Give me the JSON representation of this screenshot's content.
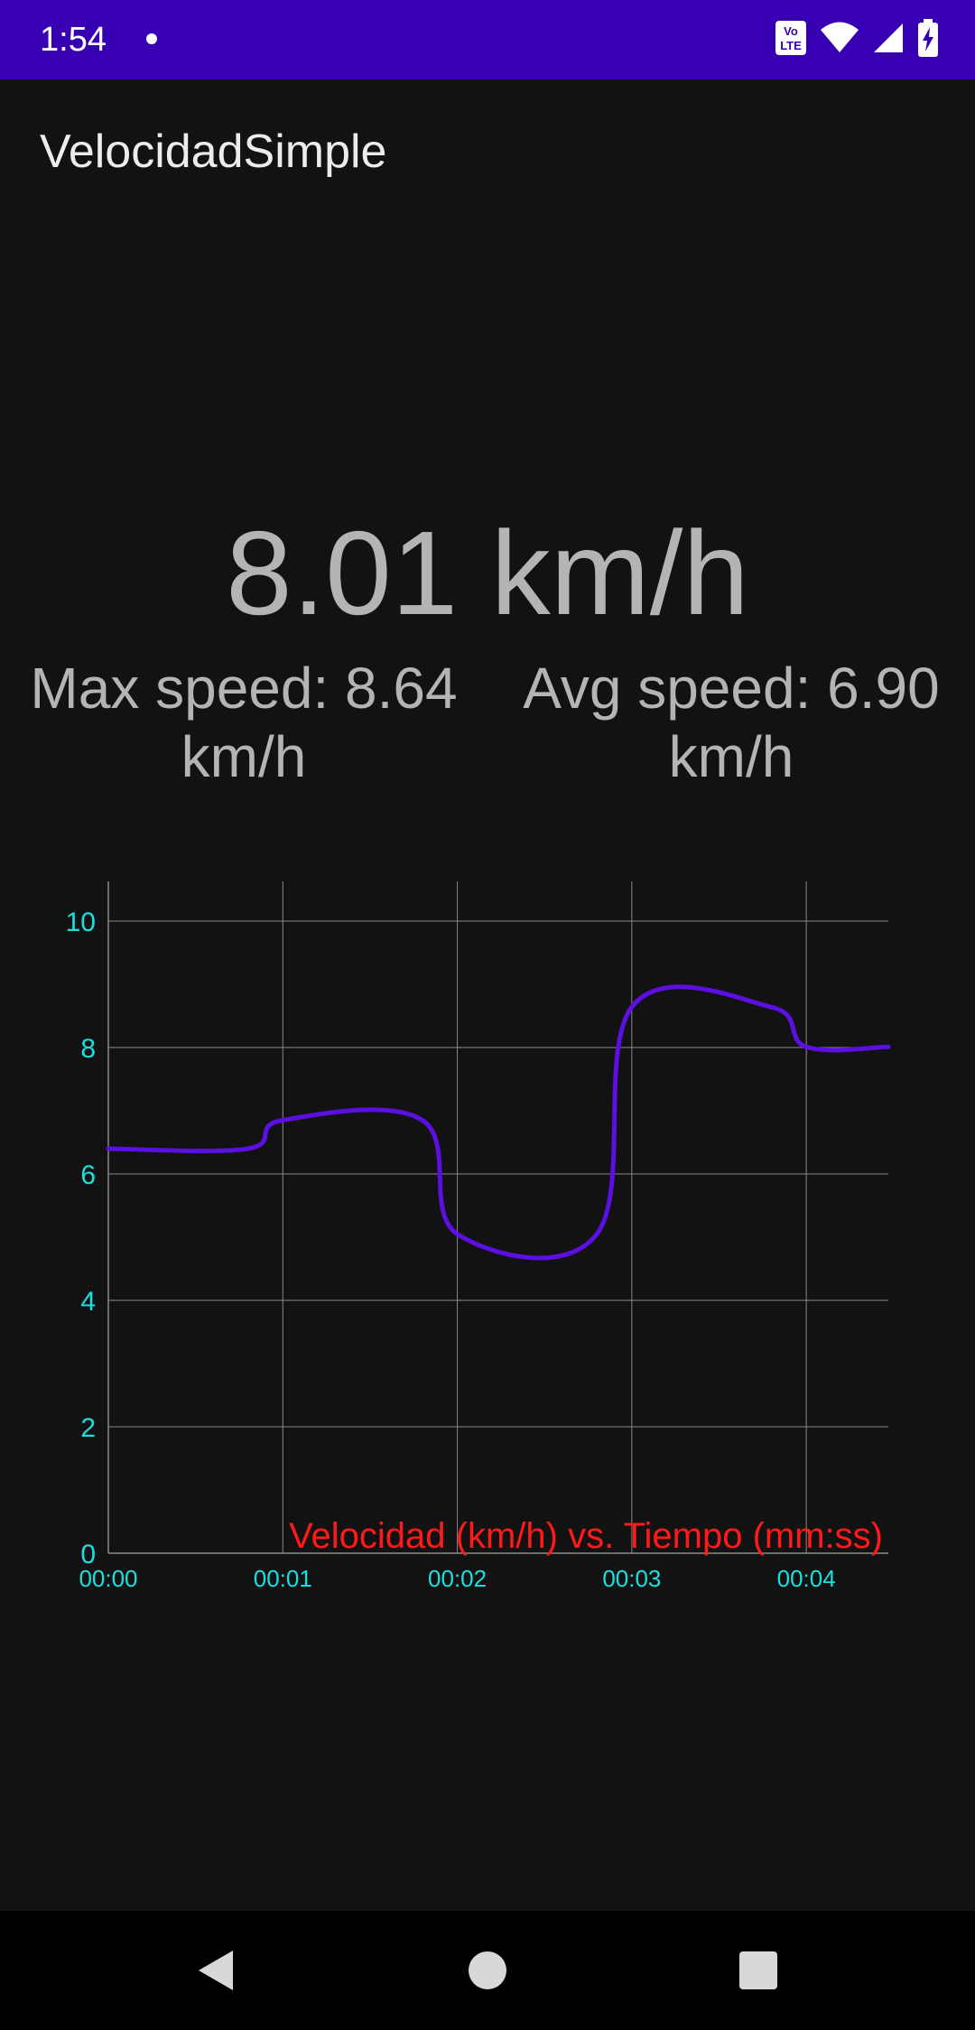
{
  "status_bar": {
    "time": "1:54",
    "icons": [
      "volte-icon",
      "wifi-icon",
      "signal-icon",
      "battery-charging-icon"
    ],
    "volte_label": "Vo LTE"
  },
  "app_bar": {
    "title": "VelocidadSimple"
  },
  "speed": {
    "current": "8.01 km/h",
    "max": "Max speed: 8.64 km/h",
    "avg": "Avg speed: 6.90 km/h"
  },
  "colors": {
    "status_bar": "#3700b3",
    "background": "#121212",
    "speed_text": "#b4b4b4",
    "series": "#5b0fe0",
    "axis_labels": "#19e0e0",
    "chart_title": "#ff1a1a",
    "grid": "#8a8a8a"
  },
  "chart_data": {
    "type": "line",
    "title": "Velocidad (km/h) vs. Tiempo (mm:ss)",
    "title_placement": "bottom-right inside plot",
    "xlabel": "",
    "ylabel": "",
    "x_tick_labels": [
      "00:00",
      "00:01",
      "00:02",
      "00:03",
      "00:04"
    ],
    "y_tick_labels": [
      "0",
      "2",
      "4",
      "6",
      "8",
      "10"
    ],
    "ylim": [
      0,
      10
    ],
    "xlim_seconds": [
      0,
      4.47
    ],
    "grid": true,
    "legend": "none",
    "smoothing": "cubic",
    "series": [
      {
        "x_seconds": [
          0,
          0.8,
          1,
          1.8,
          2,
          2.8,
          3,
          3.8,
          4,
          4.47
        ],
        "values": [
          6.4,
          6.4,
          6.85,
          6.85,
          5.05,
          5.05,
          8.64,
          8.64,
          8.01,
          8.01
        ]
      }
    ]
  },
  "nav_bar": {
    "buttons": [
      "back",
      "home",
      "recents"
    ]
  }
}
